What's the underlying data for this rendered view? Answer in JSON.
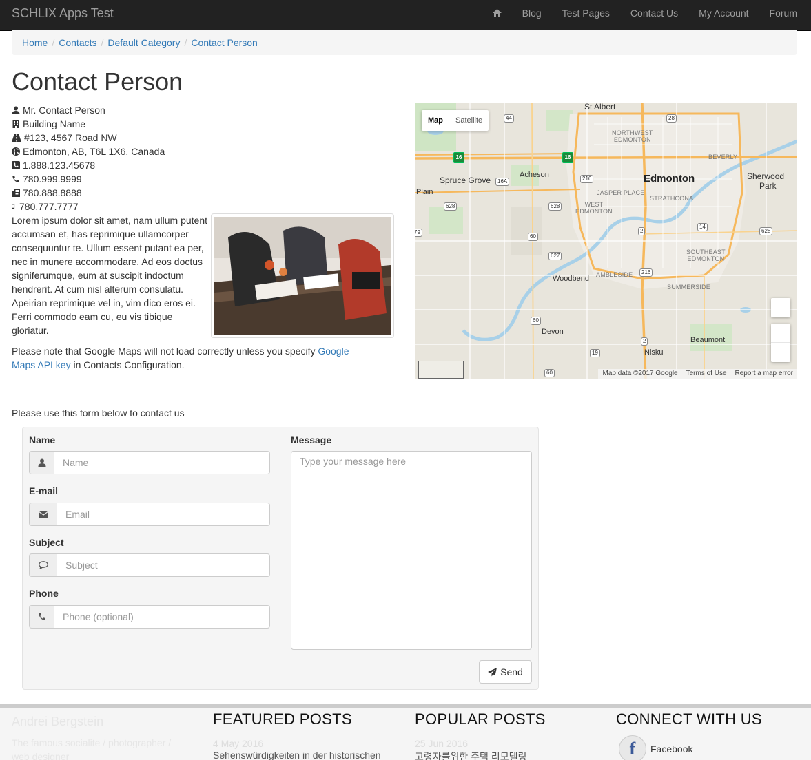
{
  "navbar": {
    "brand": "SCHLIX Apps Test",
    "items": [
      "Blog",
      "Test Pages",
      "Contact Us",
      "My Account",
      "Forum"
    ]
  },
  "breadcrumb": [
    "Home",
    "Contacts",
    "Default Category",
    "Contact Person"
  ],
  "page_title": "Contact Person",
  "contact": {
    "name": "Mr. Contact Person",
    "building": "Building Name",
    "address": "#123, 4567 Road NW",
    "city": "Edmonton, AB, T6L 1X6, Canada",
    "tollfree": "1.888.123.45678",
    "phone": "780.999.9999",
    "fax": "780.888.8888",
    "mobile": "780.777.7777",
    "description": "Lorem ipsum dolor sit amet, nam ullum putent accumsan et, has reprimique ullamcorper consequuntur te. Ullum essent putant ea per, nec in munere accommodare. Ad eos doctus signiferumque, eum at suscipit indoctum hendrerit. At cum nisl alterum consulatu. Apeirian reprimique vel in, vim dico eros ei. Ferri commodo eam cu, eu vis tibique gloriatur."
  },
  "note": {
    "before": "Please note that Google Maps will not load correctly unless you specify ",
    "link": "Google Maps API key",
    "after": " in Contacts Configuration."
  },
  "map": {
    "toggle_map": "Map",
    "toggle_satellite": "Satellite",
    "footer": [
      "Map data ©2017 Google",
      "Terms of Use",
      "Report a map error"
    ],
    "labels": {
      "st_albert": "St Albert",
      "edmonton": "Edmonton",
      "sherwood": "Sherwood",
      "park": "Park",
      "spruce_grove": "Spruce Grove",
      "acheson": "Acheson",
      "plain": "Plain",
      "woodbend": "Woodbend",
      "devon": "Devon",
      "beaumont": "Beaumont",
      "nisku": "Nisku",
      "nw_edmonton_1": "NORTHWEST",
      "nw_edmonton_2": "EDMONTON",
      "beverly": "BEVERLY",
      "jasper_place": "JASPER PLACE",
      "strathcona": "STRATHCONA",
      "west_1": "WEST",
      "west_2": "EDMONTON",
      "se_1": "SOUTHEAST",
      "se_2": "EDMONTON",
      "ambleside": "AMBLESIDE",
      "summerside": "SUMMERSIDE",
      "hwy_16a": "16A",
      "r44": "44",
      "r28": "28",
      "r216a": "216",
      "r216b": "216",
      "r628a": "628",
      "r628b": "628",
      "r628c": "628",
      "r60a": "60",
      "r60b": "60",
      "r60c": "60",
      "r627": "627",
      "r2a": "2",
      "r2b": "2",
      "r14": "14",
      "r19": "19",
      "r79": "79",
      "h16a": "16",
      "h16b": "16"
    }
  },
  "form": {
    "intro": "Please use this form below to contact us",
    "name_label": "Name",
    "name_placeholder": "Name",
    "email_label": "E-mail",
    "email_placeholder": "Email",
    "subject_label": "Subject",
    "subject_placeholder": "Subject",
    "phone_label": "Phone",
    "phone_placeholder": "Phone (optional)",
    "message_label": "Message",
    "message_placeholder": "Type your message here",
    "send_label": "Send"
  },
  "footer": {
    "brand": "Andrei Bergstein",
    "tagline": "The famous socialite / photographer / web designer",
    "featured_heading": "FEATURED POSTS",
    "featured_date": "4 May 2016",
    "featured_post": "Sehenswürdigkeiten in der historischen",
    "popular_heading": "POPULAR POSTS",
    "popular_date": "25 Jun 2016",
    "popular_post": "고령자를위한 주택 리모델링",
    "connect_heading": "CONNECT WITH US",
    "facebook": "Facebook"
  },
  "colors": {
    "navbar_bg": "#222222",
    "link": "#337ab7",
    "well_bg": "#f5f5f5"
  }
}
